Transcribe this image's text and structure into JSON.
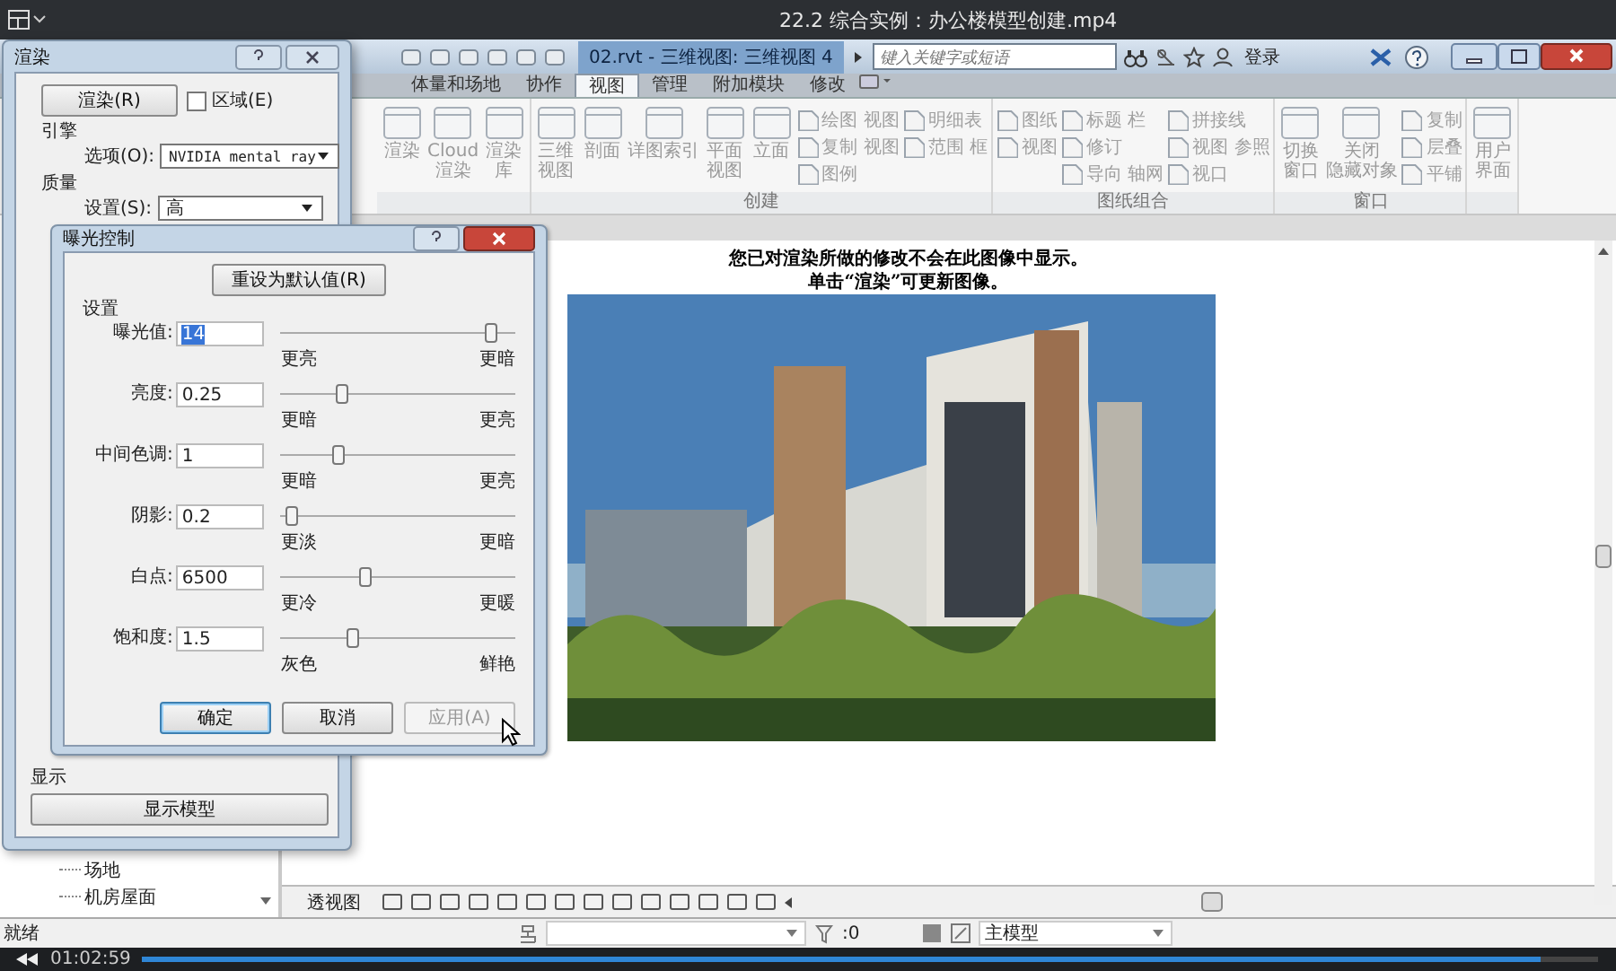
{
  "video": {
    "title": "22.2  综合实例：办公楼模型创建.mp4",
    "time": "01:02:59",
    "level": 0.96
  },
  "app_bar": {
    "document_title": "02.rvt - 三维视图: 三维视图 4",
    "search": {
      "placeholder": "键入关键字或短语"
    },
    "sign_in": "登录"
  },
  "ribbon_tabs": [
    {
      "label": "体量和场地",
      "selected": false
    },
    {
      "label": "协作",
      "selected": false
    },
    {
      "label": "视图",
      "selected": true
    },
    {
      "label": "管理",
      "selected": false
    },
    {
      "label": "附加模块",
      "selected": false
    },
    {
      "label": "修改",
      "selected": false
    }
  ],
  "ribbon_panels": [
    {
      "large": [
        [
          "渲染"
        ],
        [
          "Cloud",
          "渲染"
        ],
        [
          "渲染",
          "库"
        ]
      ]
    },
    {
      "label": "创建",
      "large": [
        [
          "三维",
          "视图"
        ],
        [
          "剖面"
        ],
        [
          "详图索引"
        ],
        [
          "平面",
          "视图"
        ],
        [
          "立面"
        ]
      ],
      "columns": [
        [
          "绘图 视图",
          "复制 视图",
          "图例"
        ],
        [
          "明细表",
          "范围 框"
        ]
      ]
    },
    {
      "label": "图纸组合",
      "columns": [
        [
          "图纸",
          "视图"
        ],
        [
          "标题 栏",
          "修订",
          "导向 轴网"
        ],
        [
          "拼接线",
          "视图 参照",
          "视口"
        ]
      ]
    },
    {
      "label": "窗口",
      "large": [
        [
          "切换",
          "窗口"
        ],
        [
          "关闭",
          "隐藏对象"
        ]
      ],
      "columns": [
        [
          "复制",
          "层叠",
          "平铺"
        ]
      ]
    },
    {
      "large": [
        [
          "用户",
          "界面"
        ]
      ]
    }
  ],
  "view": {
    "message": [
      "您已对渲染所做的修改不会在此图像中显示。",
      "单击“渲染”可更新图像。"
    ],
    "picture": {
      "kind": "picture"
    },
    "view_name": "透视图"
  },
  "project_browser": {
    "items": [
      "场地",
      "机房屋面"
    ]
  },
  "render_dialog": {
    "title": "渲染",
    "render_button": "渲染(R)",
    "region": {
      "label": "区域(E)",
      "checked": false
    },
    "engine": {
      "heading": "引擎",
      "label": "选项(O):",
      "value": "NVIDIA mental ray"
    },
    "quality": {
      "heading": "质量",
      "label": "设置(S):",
      "value": "高"
    },
    "display": {
      "heading": "显示",
      "button": "显示模型"
    }
  },
  "exposure_dialog": {
    "title": "曝光控制",
    "reset_button": "重设为默认值(R)",
    "group": "设置",
    "rows": [
      {
        "label": "曝光值:",
        "value": "14",
        "highlighted": true,
        "level": 0.89,
        "low": "更亮",
        "high": "更暗"
      },
      {
        "label": "亮度:",
        "value": "0.25",
        "highlighted": false,
        "level": 0.26,
        "low": "更暗",
        "high": "更亮"
      },
      {
        "label": "中间色调:",
        "value": "1",
        "highlighted": false,
        "level": 0.24,
        "low": "更暗",
        "high": "更亮"
      },
      {
        "label": "阴影:",
        "value": "0.2",
        "highlighted": false,
        "level": 0.04,
        "low": "更淡",
        "high": "更暗"
      },
      {
        "label": "白点:",
        "value": "6500",
        "highlighted": false,
        "level": 0.36,
        "low": "更冷",
        "high": "更暖"
      },
      {
        "label": "饱和度:",
        "value": "1.5",
        "highlighted": false,
        "level": 0.3,
        "low": "灰色",
        "high": "鲜艳"
      }
    ],
    "buttons": [
      {
        "label": "确定",
        "default": true,
        "disabled": false
      },
      {
        "label": "取消",
        "default": false,
        "disabled": false
      },
      {
        "label": "应用(A)",
        "default": false,
        "disabled": true
      }
    ]
  },
  "status_bar": {
    "text": "就绪",
    "count": ":0",
    "model": "主模型"
  }
}
